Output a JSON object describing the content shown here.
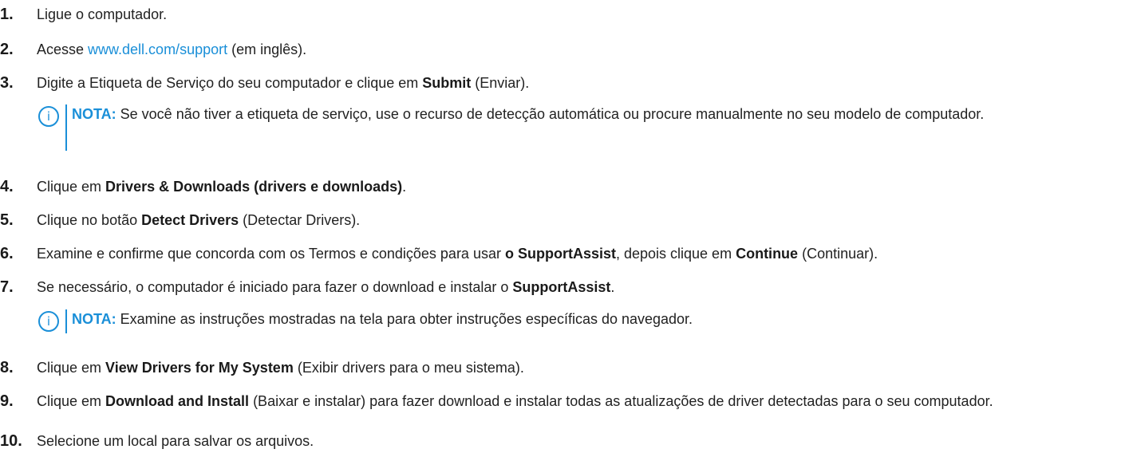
{
  "steps": [
    {
      "num": "1.",
      "text": "Ligue o computador."
    },
    {
      "num": "2.",
      "pre": "Acesse ",
      "link": "www.dell.com/support",
      "post": " (em inglês)."
    },
    {
      "num": "3.",
      "pre": "Digite a Etiqueta de Serviço do seu computador e clique em ",
      "bold": "Submit",
      "post": " (Enviar)."
    },
    {
      "num": "4.",
      "pre": "Clique em ",
      "bold": "Drivers & Downloads (drivers e downloads)",
      "post": "."
    },
    {
      "num": "5.",
      "pre": "Clique no botão ",
      "bold": "Detect Drivers",
      "post": " (Detectar Drivers)."
    },
    {
      "num": "6.",
      "pre": "Examine e confirme que concorda com os Termos e condições para usar ",
      "bold": "o SupportAssist",
      "mid": ", depois clique em ",
      "bold2": "Continue",
      "post": " (Continuar)."
    },
    {
      "num": "7.",
      "pre": "Se necessário, o computador é iniciado para fazer o download e instalar o ",
      "bold": "SupportAssist",
      "post": "."
    },
    {
      "num": "8.",
      "pre": "Clique em ",
      "bold": "View Drivers for My System",
      "post": " (Exibir drivers para o meu sistema)."
    },
    {
      "num": "9.",
      "pre": "Clique em ",
      "bold": "Download and Install",
      "post": " (Baixar e instalar) para fazer download e instalar todas as atualizações de driver detectadas para o seu computador."
    },
    {
      "num": "10.",
      "text": "Selecione um local para salvar os arquivos."
    }
  ],
  "notes": [
    {
      "icon": "i",
      "label": "NOTA:",
      "text": " Se você não tiver a etiqueta de serviço, use o recurso de detecção automática ou procure manualmente no seu modelo de computador."
    },
    {
      "icon": "i",
      "label": "NOTA:",
      "text": " Examine as instruções mostradas na tela para obter instruções específicas do navegador."
    }
  ],
  "colors": {
    "text": "#222222",
    "accent": "#1a8fd8"
  },
  "icons": {
    "note": "info-circle-icon"
  }
}
